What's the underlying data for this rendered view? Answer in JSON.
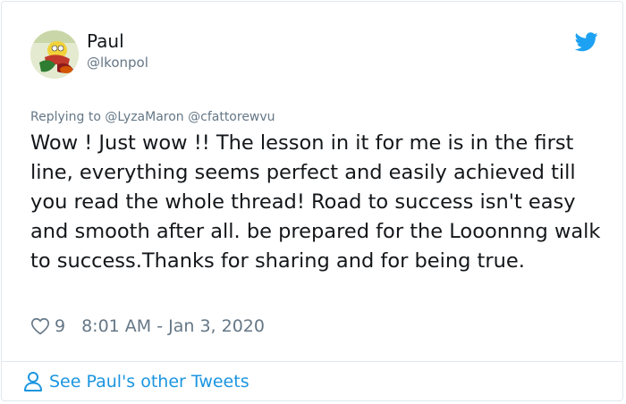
{
  "author": {
    "name": "Paul",
    "handle": "@lkonpol",
    "avatar_icon": "avatar-image"
  },
  "reply": {
    "prefix": "Replying to",
    "mentions": [
      "@LyzaMaron",
      "@cfattorewvu"
    ]
  },
  "tweet": {
    "text": "Wow ! Just wow !! The lesson in it for me is in the first line, everything seems perfect and easily achieved till you read the whole thread! Road to success isn't easy and smooth after all. be prepared for the Looonnng walk to success.Thanks for sharing and for being true.",
    "likes": "9",
    "timestamp": "8:01 AM - Jan 3, 2020"
  },
  "footer": {
    "link_label": "See Paul's other Tweets"
  },
  "icons": {
    "brand": "twitter-bird-icon",
    "like": "heart-icon",
    "profile": "person-icon"
  },
  "colors": {
    "accent": "#1b95e0",
    "twitter_blue": "#1da1f2",
    "secondary_text": "#657786",
    "primary_text": "#14171a",
    "border": "#e1e8ed"
  }
}
